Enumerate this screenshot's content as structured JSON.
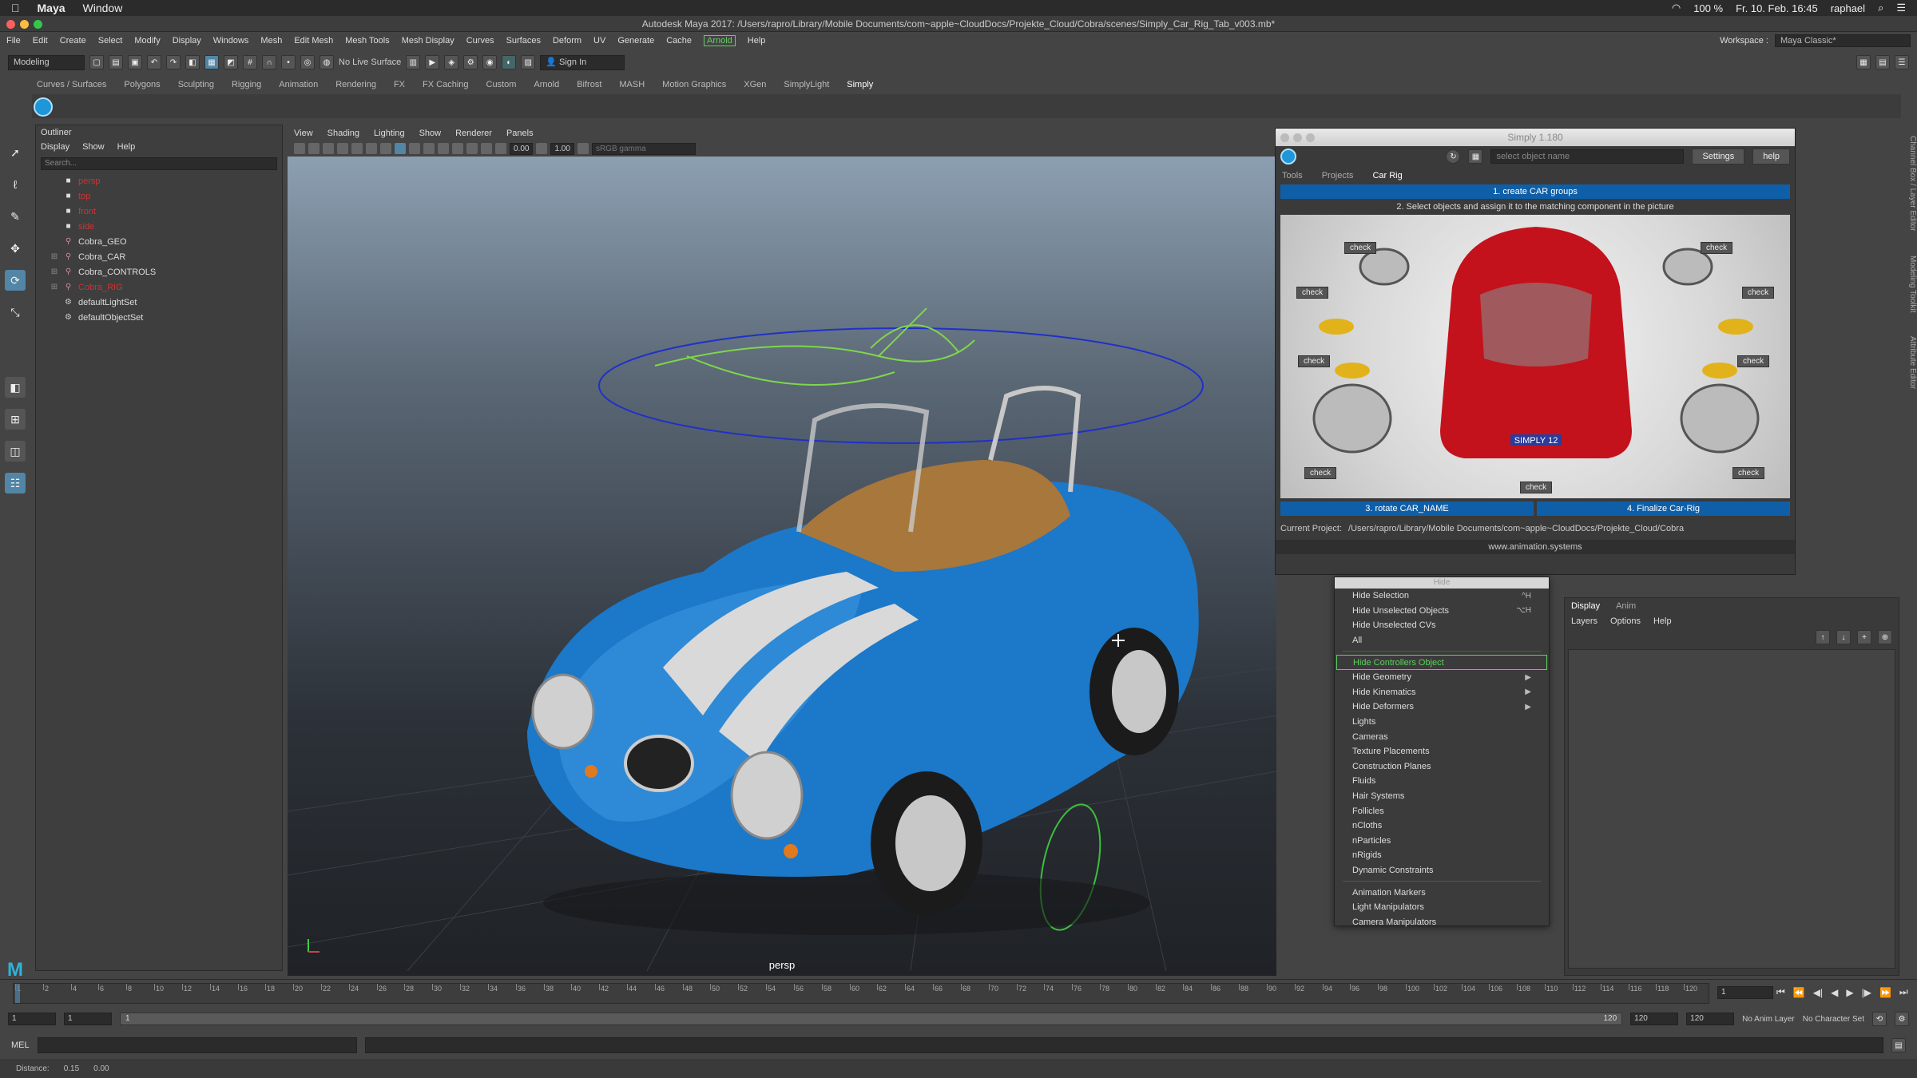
{
  "mac": {
    "app": "Maya",
    "window_menu": "Window",
    "battery": "100 %",
    "datetime": "Fr. 10. Feb.  16:45",
    "user": "raphael"
  },
  "window": {
    "title": "Autodesk Maya 2017: /Users/rapro/Library/Mobile Documents/com~apple~CloudDocs/Projekte_Cloud/Cobra/scenes/Simply_Car_Rig_Tab_v003.mb*"
  },
  "menus": [
    "File",
    "Edit",
    "Create",
    "Select",
    "Modify",
    "Display",
    "Windows",
    "Mesh",
    "Edit Mesh",
    "Mesh Tools",
    "Mesh Display",
    "Curves",
    "Surfaces",
    "Deform",
    "UV",
    "Generate",
    "Cache",
    "Arnold",
    "Help"
  ],
  "workspace": {
    "label": "Workspace :",
    "value": "Maya Classic*"
  },
  "status": {
    "mode": "Modeling",
    "live_surface": "No Live Surface",
    "sign_in": "Sign In"
  },
  "shelf_tabs": [
    "Curves / Surfaces",
    "Polygons",
    "Sculpting",
    "Rigging",
    "Animation",
    "Rendering",
    "FX",
    "FX Caching",
    "Custom",
    "Arnold",
    "Bifrost",
    "MASH",
    "Motion Graphics",
    "XGen",
    "SimplyLight",
    "Simply"
  ],
  "outliner": {
    "title": "Outliner",
    "menu": [
      "Display",
      "Show",
      "Help"
    ],
    "search_placeholder": "Search...",
    "nodes": [
      {
        "label": "persp",
        "icon": "camera-icon",
        "red": true
      },
      {
        "label": "top",
        "icon": "camera-icon",
        "red": true
      },
      {
        "label": "front",
        "icon": "camera-icon",
        "red": true
      },
      {
        "label": "side",
        "icon": "camera-icon",
        "red": true
      },
      {
        "label": "Cobra_GEO",
        "icon": "transform-icon",
        "red": false
      },
      {
        "label": "Cobra_CAR",
        "icon": "transform-icon",
        "red": false,
        "expand": true
      },
      {
        "label": "Cobra_CONTROLS",
        "icon": "transform-icon",
        "red": false,
        "expand": true
      },
      {
        "label": "Cobra_RIG",
        "icon": "transform-icon",
        "red": true,
        "expand": true
      },
      {
        "label": "defaultLightSet",
        "icon": "set-icon",
        "red": false
      },
      {
        "label": "defaultObjectSet",
        "icon": "set-icon",
        "red": false
      }
    ]
  },
  "viewport": {
    "menu": [
      "View",
      "Shading",
      "Lighting",
      "Show",
      "Renderer",
      "Panels"
    ],
    "near_value": "0.00",
    "far_value": "1.00",
    "color_space": "sRGB gamma",
    "camera_label": "persp"
  },
  "simply": {
    "title": "Simply 1.180",
    "object_placeholder": "select object name",
    "settings_label": "Settings",
    "help_label": "help",
    "tabs": [
      "Tools",
      "Projects",
      "Car Rig"
    ],
    "step1": "1. create CAR groups",
    "step2": "2. Select objects and assign it to the matching component in the picture",
    "check_label": "check",
    "plate": "SIMPLY 12",
    "step3": "3. rotate CAR_NAME",
    "step4": "4. Finalize Car-Rig",
    "project_label": "Current Project:",
    "project_path": "/Users/rapro/Library/Mobile Documents/com~apple~CloudDocs/Projekte_Cloud/Cobra",
    "url": "www.animation.systems"
  },
  "hide_menu": {
    "title": "Hide",
    "items": [
      {
        "label": "Hide Selection",
        "shortcut": "^H"
      },
      {
        "label": "Hide Unselected Objects",
        "shortcut": "⌥H"
      },
      {
        "label": "Hide Unselected CVs"
      },
      {
        "label": "All"
      },
      {
        "sep": true
      },
      {
        "label": "Hide Controllers Object",
        "highlight": true
      },
      {
        "label": "Hide Geometry",
        "sub": true
      },
      {
        "label": "Hide Kinematics",
        "sub": true
      },
      {
        "label": "Hide Deformers",
        "sub": true
      },
      {
        "label": "Lights"
      },
      {
        "label": "Cameras"
      },
      {
        "label": "Texture Placements"
      },
      {
        "label": "Construction Planes"
      },
      {
        "label": "Fluids"
      },
      {
        "label": "Hair Systems"
      },
      {
        "label": "Follicles"
      },
      {
        "label": "nCloths"
      },
      {
        "label": "nParticles"
      },
      {
        "label": "nRigids"
      },
      {
        "label": "Dynamic Constraints"
      },
      {
        "sep": true
      },
      {
        "label": "Animation Markers"
      },
      {
        "label": "Light Manipulators"
      },
      {
        "label": "Camera Manipulators"
      }
    ]
  },
  "layer_panel": {
    "tabs": [
      "Display",
      "Anim"
    ],
    "menu": [
      "Layers",
      "Options",
      "Help"
    ]
  },
  "side_tabs": [
    "Channel Box / Layer Editor",
    "Modeling Toolkit",
    "Attribute Editor"
  ],
  "timeline": {
    "ticks": [
      "1",
      "2",
      "4",
      "6",
      "8",
      "10",
      "12",
      "14",
      "16",
      "18",
      "20",
      "22",
      "24",
      "26",
      "28",
      "30",
      "32",
      "34",
      "36",
      "38",
      "40",
      "42",
      "44",
      "46",
      "48",
      "50",
      "52",
      "54",
      "56",
      "58",
      "60",
      "62",
      "64",
      "66",
      "68",
      "70",
      "72",
      "74",
      "76",
      "78",
      "80",
      "82",
      "84",
      "86",
      "88",
      "90",
      "92",
      "94",
      "96",
      "98",
      "100",
      "102",
      "104",
      "106",
      "108",
      "110",
      "112",
      "114",
      "116",
      "118",
      "120"
    ],
    "current_frame": "1"
  },
  "range": {
    "start": "1",
    "playback_start": "1",
    "range_start_label": "1",
    "range_end_label": "120",
    "playback_end": "120",
    "end": "120",
    "anim_layer": "No Anim Layer",
    "char_set": "No Character Set"
  },
  "command": {
    "label": "MEL"
  },
  "help": {
    "label": "Distance:",
    "v1": "0.15",
    "v2": "0.00"
  },
  "colors": {
    "accent": "#5285a6",
    "simply_blue": "#0f5fa8",
    "highlight_green": "#5bd15b",
    "car_blue": "#1c78c8"
  }
}
